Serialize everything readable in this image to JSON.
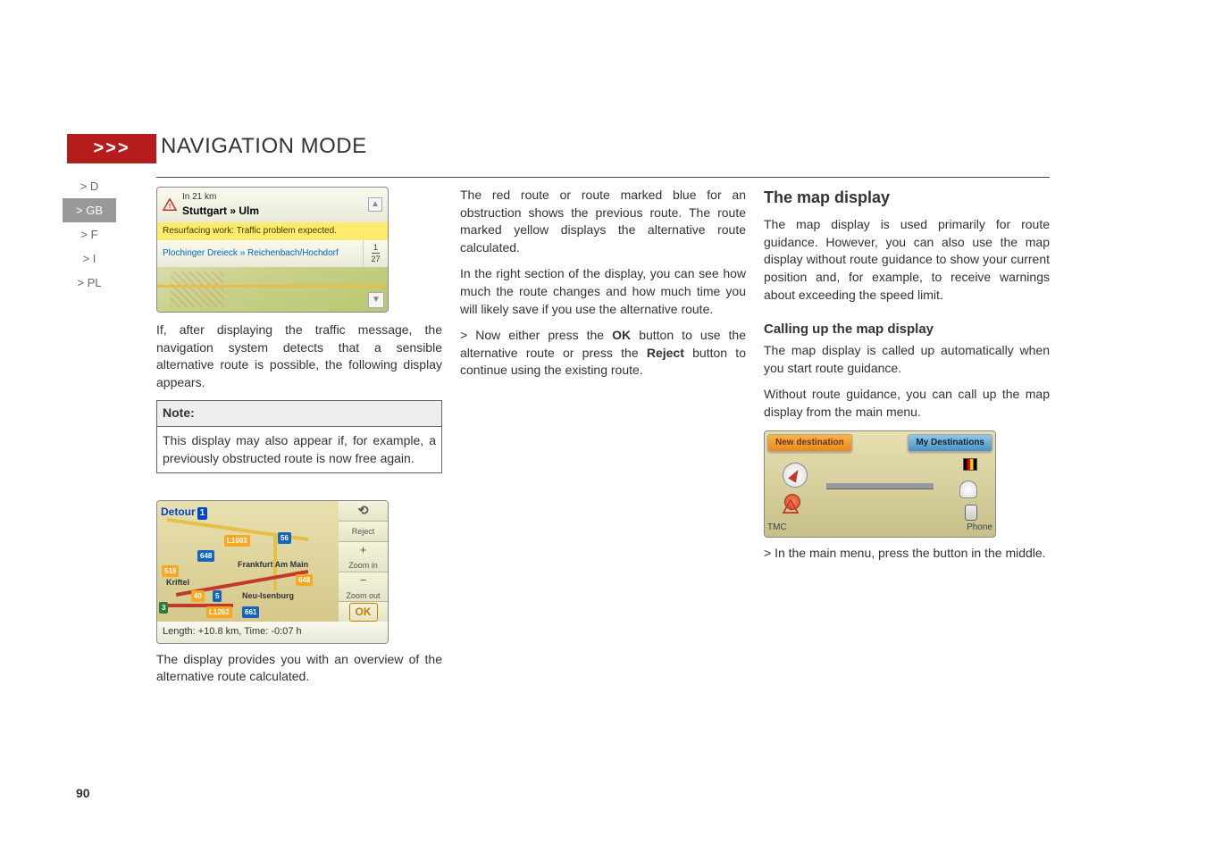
{
  "header": {
    "chevrons": ">>>",
    "title": "NAVIGATION MODE"
  },
  "sidebar": {
    "d": "> D",
    "gb": "> GB",
    "f": "> F",
    "i": "> I",
    "pl": "> PL"
  },
  "page_number": "90",
  "col1": {
    "sc1": {
      "in_km": "In 21 km",
      "route": "Stuttgart » Ulm",
      "yellow": "Resurfacing work: Traffic problem expected.",
      "detail": "Plochinger Dreieck » Reichenbach/Hochdorf",
      "frac_top": "1",
      "frac_bot": "27",
      "scroll_up": "▲",
      "scroll_down": "▼"
    },
    "p1": "If, after displaying the traffic message, the navigation system detects that a sensible alternative route is possible, the following display appears.",
    "note_head": "Note:",
    "note_body": "This display may also appear if, for example, a previously obstructed route is now free again.",
    "sc2": {
      "detour": "Detour",
      "badge": "1",
      "back": "⟲",
      "reject": "Reject",
      "plus": "+",
      "zoomin": "Zoom in",
      "minus": "−",
      "zoomout": "Zoom out",
      "ok": "OK",
      "shield_3": "3",
      "shield_5": "5",
      "shield_40": "40",
      "shield_L1003": "L1003",
      "shield_L1262": "L1262",
      "shield_519": "519",
      "shield_648": "648",
      "shield_648b": "648",
      "shield_661": "661",
      "shield_56": "56",
      "city_kriftel": "Kriftel",
      "city_frankfurt": "Frankfurt Am Main",
      "city_neu": "Neu-Isenburg",
      "status": "Length: +10.8 km, Time: -0:07 h"
    },
    "p2": "The display provides you with an overview of the alternative route calculated."
  },
  "col2": {
    "p1": "The red route or route marked blue for an obstruction shows the previous route. The route marked yellow displays the alternative route calculated.",
    "p2": "In the right section of the display, you can see how much the route changes and how much time you will likely save if you use the alternative route.",
    "li_pre": "> Now either press the ",
    "li_ok": "OK",
    "li_mid": " button to use the alternative route or press the ",
    "li_rej": "Reject",
    "li_post": " button to continue using the existing route."
  },
  "col3": {
    "h2": "The map display",
    "p1": "The map display is used primarily for route guidance. However, you can also use the map display without route guidance to show your current position and, for example, to receive warnings about exceeding the speed limit.",
    "h3": "Calling up the map display",
    "p2": "The map display is called up automatically when you start route guidance.",
    "p3": "Without route guidance, you can call up the map display from the main menu.",
    "sc3": {
      "newdest": "New destination",
      "mydest": "My Destinations",
      "tmc": "TMC",
      "phone": "Phone"
    },
    "li": "> In the main menu, press the button in the middle."
  }
}
